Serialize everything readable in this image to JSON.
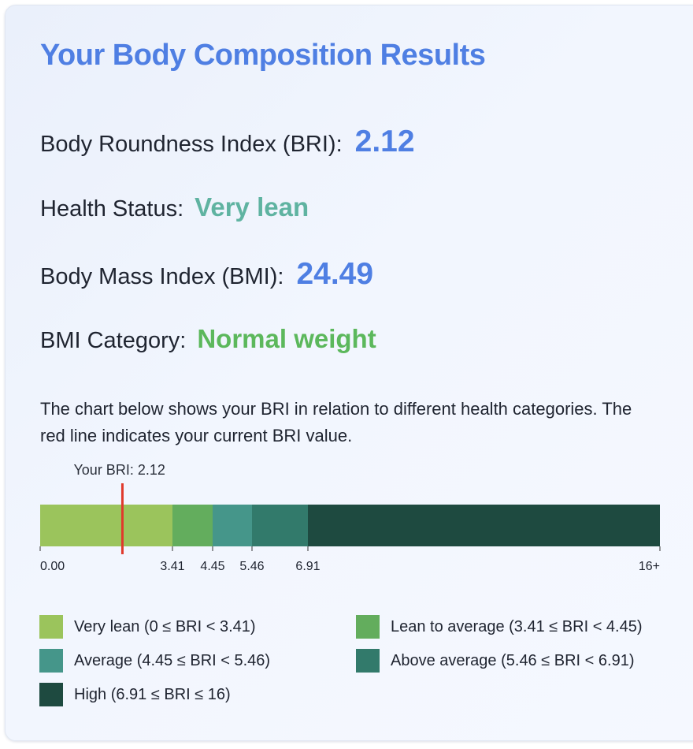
{
  "title": "Your Body Composition Results",
  "metrics": {
    "bri": {
      "label": "Body Roundness Index (BRI):",
      "value": "2.12"
    },
    "health_status": {
      "label": "Health Status:",
      "value": "Very lean",
      "color": "#5fb3a1"
    },
    "bmi": {
      "label": "Body Mass Index (BMI):",
      "value": "24.49"
    },
    "bmi_category": {
      "label": "BMI Category:",
      "value": "Normal weight",
      "color": "#5cb85c"
    }
  },
  "description": "The chart below shows your BRI in relation to different health categories. The red line indicates your current BRI value.",
  "chart_data": {
    "type": "bar",
    "orientation": "horizontal-segmented",
    "marker": {
      "label": "Your BRI: 2.12",
      "value": 2.12,
      "color": "#e0392b"
    },
    "axis_ticks": [
      "0.00",
      "3.41",
      "4.45",
      "5.46",
      "6.91",
      "16+"
    ],
    "segments": [
      {
        "name": "Very lean",
        "from": 0,
        "to": 3.41,
        "color": "#9bc45c"
      },
      {
        "name": "Lean to average",
        "from": 3.41,
        "to": 4.45,
        "color": "#63ad5d"
      },
      {
        "name": "Average",
        "from": 4.45,
        "to": 5.46,
        "color": "#45968a"
      },
      {
        "name": "Above average",
        "from": 5.46,
        "to": 6.91,
        "color": "#327a6b"
      },
      {
        "name": "High",
        "from": 6.91,
        "to": 16,
        "color": "#1e4a40"
      }
    ]
  },
  "legend": [
    {
      "text": "Very lean (0 ≤ BRI < 3.41)",
      "color": "#9bc45c"
    },
    {
      "text": "Lean to average (3.41 ≤ BRI < 4.45)",
      "color": "#63ad5d"
    },
    {
      "text": "Average (4.45 ≤ BRI < 5.46)",
      "color": "#45968a"
    },
    {
      "text": "Above average (5.46 ≤ BRI < 6.91)",
      "color": "#327a6b"
    },
    {
      "text": "High (6.91 ≤ BRI ≤ 16)",
      "color": "#1e4a40"
    }
  ]
}
